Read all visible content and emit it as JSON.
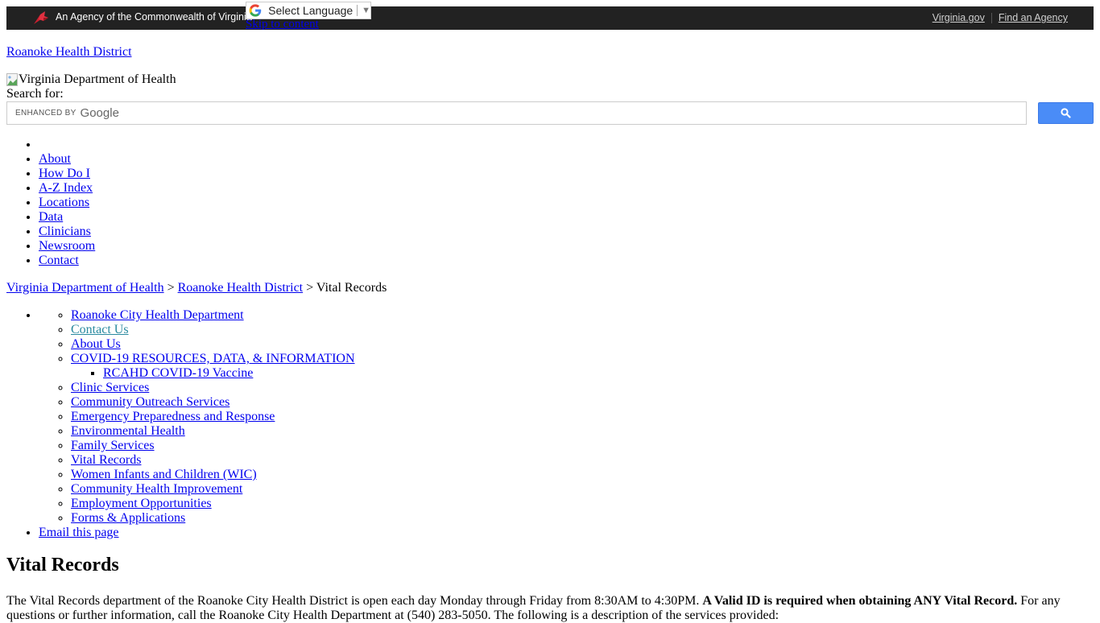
{
  "topbar": {
    "agency_text": "An Agency of the Commonwealth of Virginia",
    "links": [
      {
        "label": "Virginia.gov"
      },
      {
        "label": "Find an Agency"
      }
    ],
    "background": "#222222"
  },
  "translate": {
    "label": "Select Language",
    "arrow": "▼"
  },
  "skip_link": "Skip to content",
  "site_link": "Roanoke Health District",
  "logo_alt": "Virginia Department of Health",
  "search": {
    "label": "Search for:",
    "enhanced_by": "ENHANCED BY",
    "google_word": "Google",
    "value": "",
    "button_color": "#4a8cf7"
  },
  "main_nav": {
    "items": [
      {
        "label": ""
      },
      {
        "label": "About"
      },
      {
        "label": "How Do I"
      },
      {
        "label": "A-Z Index"
      },
      {
        "label": "Locations"
      },
      {
        "label": "Data"
      },
      {
        "label": "Clinicians"
      },
      {
        "label": "Newsroom"
      },
      {
        "label": "Contact"
      }
    ]
  },
  "breadcrumb": {
    "items": [
      {
        "label": "Virginia Department of Health"
      },
      {
        "label": "Roanoke Health District"
      },
      {
        "label": "Vital Records"
      }
    ],
    "separator": ">"
  },
  "side_nav": {
    "items": [
      {
        "label": "Roanoke City Health Department"
      },
      {
        "label": "Contact Us"
      },
      {
        "label": "About Us"
      },
      {
        "label": "COVID-19 RESOURCES, DATA, & INFORMATION",
        "children": [
          {
            "label": "RCAHD COVID-19 Vaccine"
          }
        ]
      },
      {
        "label": "Clinic Services"
      },
      {
        "label": "Community Outreach Services"
      },
      {
        "label": "Emergency Preparedness and Response"
      },
      {
        "label": "Environmental Health"
      },
      {
        "label": "Family Services"
      },
      {
        "label": "Vital Records"
      },
      {
        "label": "Women Infants and Children (WIC)"
      },
      {
        "label": "Community Health Improvement"
      },
      {
        "label": "Employment Opportunities"
      },
      {
        "label": "Forms & Applications"
      }
    ],
    "email_link": "Email this page",
    "visited_color": "#2a8aa0"
  },
  "content": {
    "title": "Vital Records",
    "intro_part1": "The Vital Records department of the Roanoke City Health District is open each day Monday through Friday from 8:30AM to 4:30PM. ",
    "intro_bold": "A Valid ID is required when obtaining ANY Vital Record.",
    "intro_part2": " For any questions or further information, call the Roanoke City Health Department at (540) 283-5050. The following is a description of the services provided:"
  }
}
